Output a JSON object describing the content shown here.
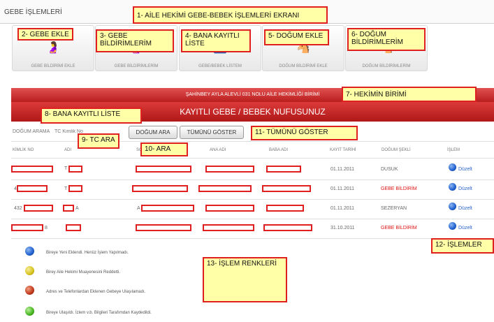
{
  "header": {
    "title": "GEBE İŞLEMLERİ"
  },
  "tiles": [
    {
      "label": "GEBE BİLDİRİMİ EKLE",
      "icon": "pregnant-woman-add-icon",
      "glyph": "🤰"
    },
    {
      "label": "GEBE BİLDİRİMLERİM",
      "icon": "pregnant-woman-list-icon",
      "glyph": "🤰"
    },
    {
      "label": "GEBE/BEBEK LİSTEM",
      "icon": "stroller-icon",
      "glyph": "🚼"
    },
    {
      "label": "DOĞUM BİLDİRİMİ EKLE",
      "icon": "rocking-horse-add-icon",
      "glyph": "🐴"
    },
    {
      "label": "DOĞUM BİLDİRİMLERİM",
      "icon": "rocking-horse-list-icon",
      "glyph": "🐴"
    }
  ],
  "unit_bar": "ŞAHİNBEY AYLA ALEVLİ 031 NOLU AİLE HEKİMLİĞİ BİRİMİ",
  "main_title": "KAYITLI GEBE / BEBEK NUFUSUNUZ",
  "search": {
    "label": "DOĞUM ARAMA",
    "placeholder": "TC Kimlik No",
    "search_button": "DOĞUM ARA",
    "show_all_button": "TÜMÜNÜ GÖSTER"
  },
  "columns": [
    "KİMLİK NO",
    "ADI",
    "SOYADI",
    "ANA ADI",
    "BABA ADI",
    "KAYIT TARİHİ",
    "DOĞUM ŞEKLİ",
    "İŞLEM"
  ],
  "rows": [
    {
      "kimlik": "",
      "adi": "T",
      "tarih": "01.11.2011",
      "sekil": "DUSUK",
      "sekil_red": false,
      "islem": "Düzelt"
    },
    {
      "kimlik": "4",
      "adi": "T",
      "tarih": "01.11.2011",
      "sekil": "GEBE BİLDİRİM",
      "sekil_red": true,
      "islem": "Düzelt"
    },
    {
      "kimlik": "432",
      "adi": "A",
      "soyadi": "A",
      "tarih": "01.11.2011",
      "sekil": "SEZERYAN",
      "sekil_red": false,
      "islem": "Düzelt"
    },
    {
      "kimlik": "8",
      "adi": "",
      "tarih": "31.10.2011",
      "sekil": "GEBE BİLDİRİM",
      "sekil_red": true,
      "islem": "Düzelt"
    }
  ],
  "legend": [
    {
      "color": "#1f5fcf",
      "text": "Bireye Yeni Eklendi. Henüz İşlem Yapılmadı."
    },
    {
      "color": "#d8c21c",
      "text": "Birey Aile Hekimi Muayenesini Reddetti."
    },
    {
      "color": "#c0361a",
      "text": "Adres ve Telefonlardan Eklenen Gebeye Ulaşılamadı."
    },
    {
      "color": "#45b51f",
      "text": "Bireye Ulaşıldı. İzlem v.b. Bilgileri Tarafımdan Kaydedildi."
    }
  ],
  "annotations": {
    "n1": "1- AİLE HEKİMİ GEBE-BEBEK İŞLEMLERİ EKRANI",
    "n2": "2- GEBE EKLE",
    "n3": "3- GEBE BİLDİRİMLERİM",
    "n4": "4- BANA KAYITLI LİSTE",
    "n5": "5- DOĞUM EKLE",
    "n6": "6- DOĞUM BİLDİRİMLERİM",
    "n7": "7- HEKİMİN BİRİMİ",
    "n8": "8- BANA KAYITLI LİSTE",
    "n9": "9- TC ARA",
    "n10": "10- ARA",
    "n11": "11- TÜMÜNÜ GÖSTER",
    "n12": "12- İŞLEMLER",
    "n13": "13- İŞLEM RENKLERİ"
  }
}
